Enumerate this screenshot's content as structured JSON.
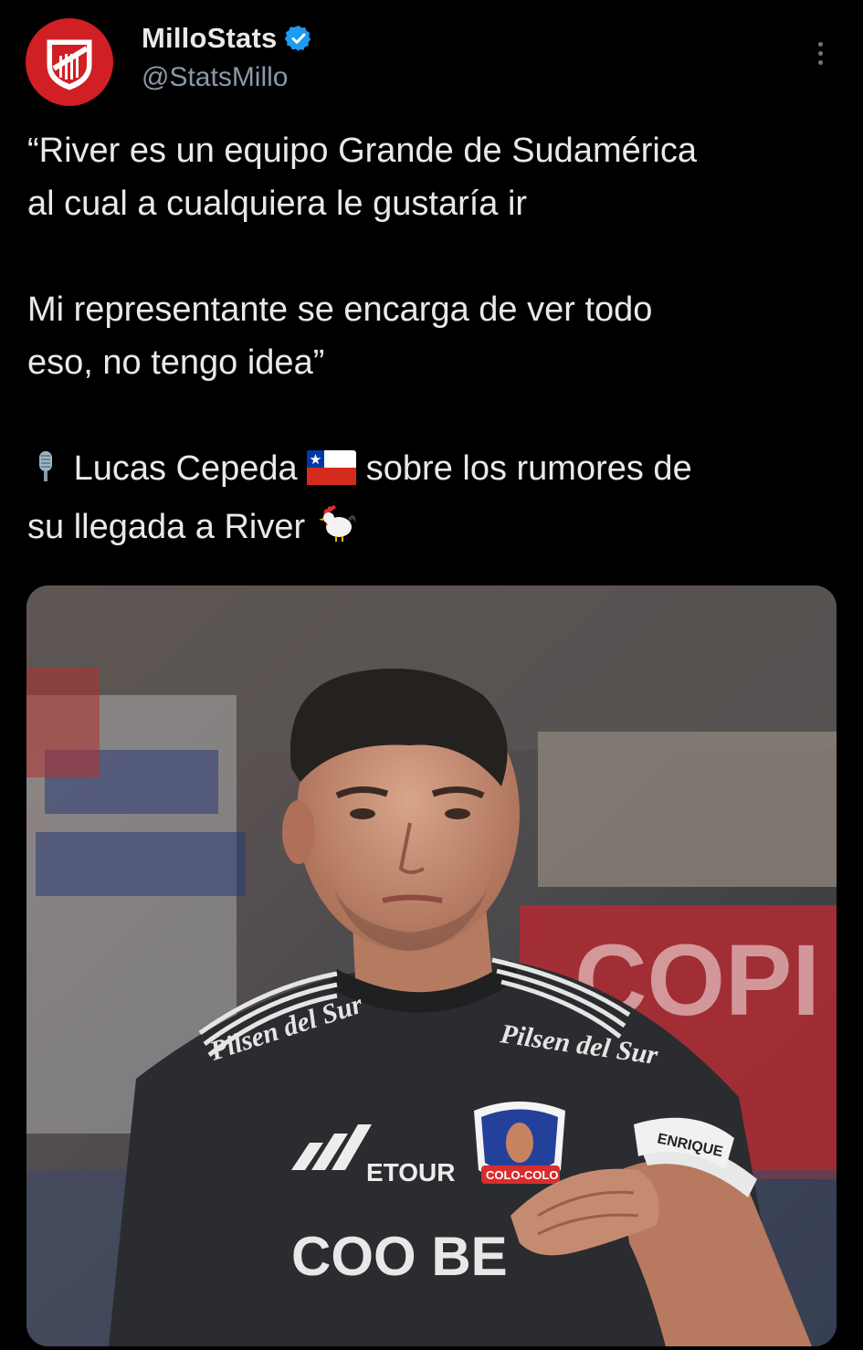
{
  "author": {
    "display_name": "MilloStats",
    "handle": "@StatsMillo",
    "verified": true,
    "avatar_icon": "river-plate-crest-icon"
  },
  "tweet": {
    "line1a": "“River es un equipo Grande de Sudamérica",
    "line1b": "al cual a cualquiera le gustaría ir",
    "line2a": "Mi representante se encarga de ver todo",
    "line2b": "eso, no tengo idea”",
    "line3a_pre": "Lucas Cepeda",
    "line3a_post": "sobre los rumores de",
    "line3b": "su llegada a River",
    "emoji": [
      "microphone-icon",
      "chile-flag-icon",
      "rooster-icon"
    ]
  },
  "media": {
    "jersey_sponsor_left": "Pilsen del Sur",
    "jersey_sponsor_right": "Pilsen del Sur",
    "jersey_brand": "ETOUR",
    "jersey_front": "COO BE",
    "crest_label": "COLO-COLO",
    "armband": "ENRIQUE",
    "banner_text": "COPI"
  },
  "colors": {
    "background": "#000000",
    "text": "#e7e9ea",
    "muted": "#8b98a5",
    "verified_blue": "#1d9bf0",
    "avatar_red": "#d11f26"
  }
}
